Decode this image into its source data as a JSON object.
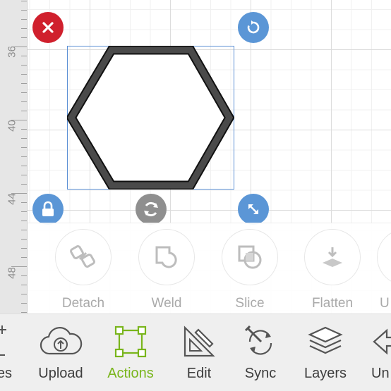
{
  "ruler": {
    "marks": [
      "36",
      "40",
      "44",
      "48"
    ]
  },
  "actions": {
    "items": [
      {
        "label": "Detach",
        "icon": "detach-icon"
      },
      {
        "label": "Weld",
        "icon": "weld-icon"
      },
      {
        "label": "Slice",
        "icon": "slice-icon"
      },
      {
        "label": "Flatten",
        "icon": "flatten-icon"
      },
      {
        "label": "U"
      }
    ]
  },
  "toolbar": {
    "items": [
      {
        "label": "es",
        "icon": "shapes-icon"
      },
      {
        "label": "Upload",
        "icon": "upload-cloud-icon"
      },
      {
        "label": "Actions",
        "icon": "actions-icon",
        "active": true
      },
      {
        "label": "Edit",
        "icon": "edit-icon"
      },
      {
        "label": "Sync",
        "icon": "sync-icon"
      },
      {
        "label": "Layers",
        "icon": "layers-icon"
      },
      {
        "label": "Un",
        "icon": "undo-icon"
      }
    ]
  },
  "colors": {
    "accent": "#79b51c",
    "delete": "#d0202d",
    "handle": "#5b96d6",
    "selection": "#5b8fd4"
  }
}
